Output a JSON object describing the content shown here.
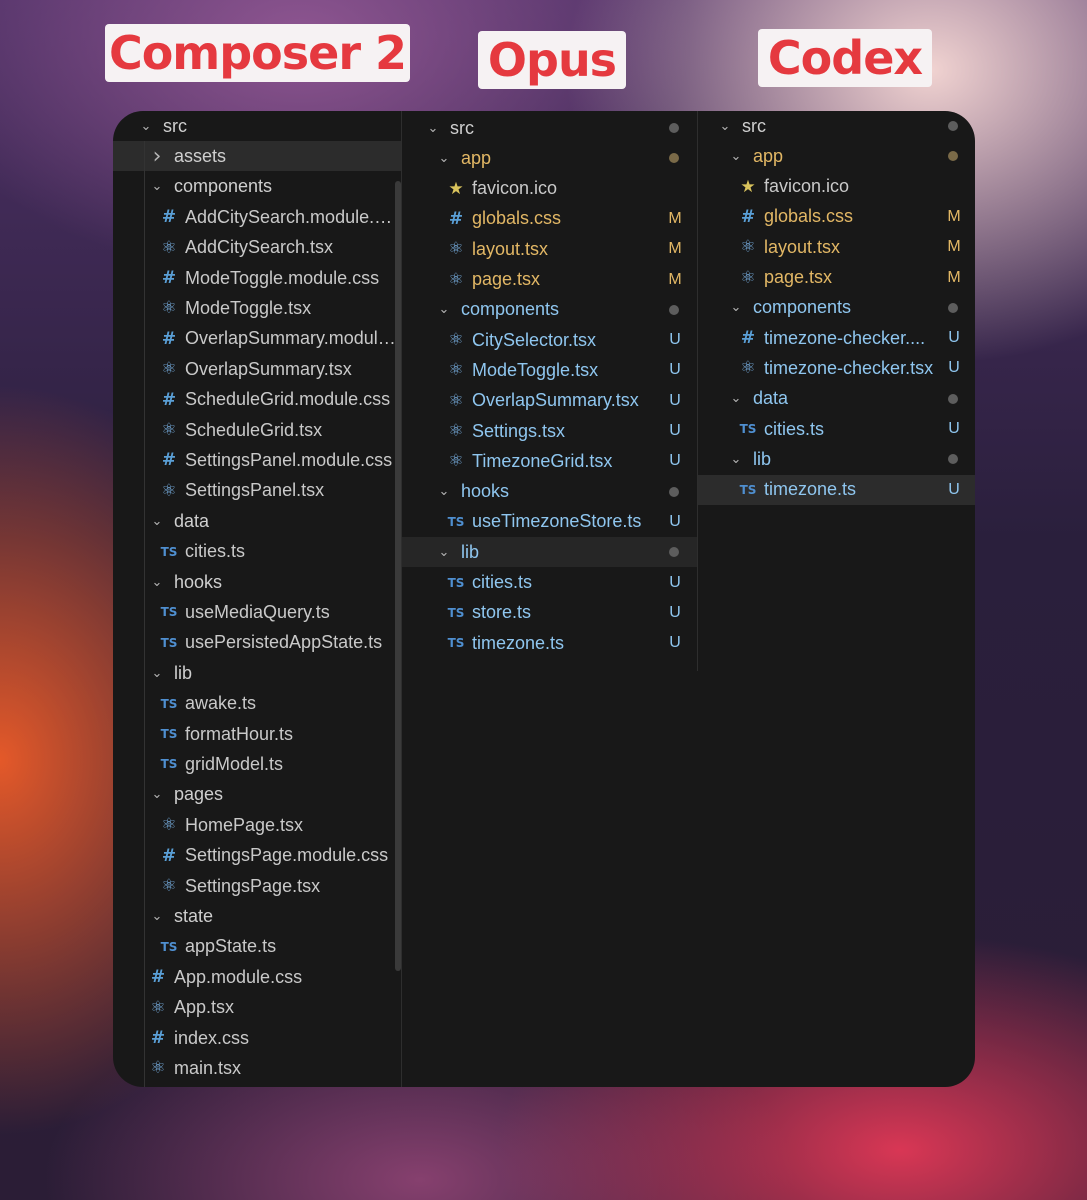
{
  "labels": {
    "left": "Composer 2",
    "middle": "Opus",
    "right": "Codex"
  },
  "composer": {
    "rows": [
      {
        "type": "folder",
        "chev": "v",
        "name": "src",
        "level": 0
      },
      {
        "type": "folder",
        "chev": ">",
        "name": "assets",
        "level": 1,
        "selected": true
      },
      {
        "type": "folder",
        "chev": "v",
        "name": "components",
        "level": 1
      },
      {
        "type": "file",
        "icon": "hash",
        "name": "AddCitySearch.module.css",
        "level": 2
      },
      {
        "type": "file",
        "icon": "react",
        "name": "AddCitySearch.tsx",
        "level": 2
      },
      {
        "type": "file",
        "icon": "hash",
        "name": "ModeToggle.module.css",
        "level": 2
      },
      {
        "type": "file",
        "icon": "react",
        "name": "ModeToggle.tsx",
        "level": 2
      },
      {
        "type": "file",
        "icon": "hash",
        "name": "OverlapSummary.module...",
        "level": 2
      },
      {
        "type": "file",
        "icon": "react",
        "name": "OverlapSummary.tsx",
        "level": 2
      },
      {
        "type": "file",
        "icon": "hash",
        "name": "ScheduleGrid.module.css",
        "level": 2
      },
      {
        "type": "file",
        "icon": "react",
        "name": "ScheduleGrid.tsx",
        "level": 2
      },
      {
        "type": "file",
        "icon": "hash",
        "name": "SettingsPanel.module.css",
        "level": 2
      },
      {
        "type": "file",
        "icon": "react",
        "name": "SettingsPanel.tsx",
        "level": 2
      },
      {
        "type": "folder",
        "chev": "v",
        "name": "data",
        "level": 1
      },
      {
        "type": "file",
        "icon": "ts",
        "name": "cities.ts",
        "level": 2
      },
      {
        "type": "folder",
        "chev": "v",
        "name": "hooks",
        "level": 1
      },
      {
        "type": "file",
        "icon": "ts",
        "name": "useMediaQuery.ts",
        "level": 2
      },
      {
        "type": "file",
        "icon": "ts",
        "name": "usePersistedAppState.ts",
        "level": 2
      },
      {
        "type": "folder",
        "chev": "v",
        "name": "lib",
        "level": 1
      },
      {
        "type": "file",
        "icon": "ts",
        "name": "awake.ts",
        "level": 2
      },
      {
        "type": "file",
        "icon": "ts",
        "name": "formatHour.ts",
        "level": 2
      },
      {
        "type": "file",
        "icon": "ts",
        "name": "gridModel.ts",
        "level": 2
      },
      {
        "type": "folder",
        "chev": "v",
        "name": "pages",
        "level": 1
      },
      {
        "type": "file",
        "icon": "react",
        "name": "HomePage.tsx",
        "level": 2
      },
      {
        "type": "file",
        "icon": "hash",
        "name": "SettingsPage.module.css",
        "level": 2
      },
      {
        "type": "file",
        "icon": "react",
        "name": "SettingsPage.tsx",
        "level": 2
      },
      {
        "type": "folder",
        "chev": "v",
        "name": "state",
        "level": 1
      },
      {
        "type": "file",
        "icon": "ts",
        "name": "appState.ts",
        "level": 2
      },
      {
        "type": "file",
        "icon": "hash",
        "name": "App.module.css",
        "level": 1
      },
      {
        "type": "file",
        "icon": "react",
        "name": "App.tsx",
        "level": 1
      },
      {
        "type": "file",
        "icon": "hash",
        "name": "index.css",
        "level": 1
      },
      {
        "type": "file",
        "icon": "react",
        "name": "main.tsx",
        "level": 1
      }
    ]
  },
  "opus": {
    "rows": [
      {
        "type": "folder",
        "chev": "v",
        "name": "src",
        "level": 0,
        "dot": true
      },
      {
        "type": "folder",
        "chev": "v",
        "name": "app",
        "level": 1,
        "dot": true,
        "dotColor": "#7a6a48",
        "nameColor": "#e2b765"
      },
      {
        "type": "file",
        "icon": "star",
        "name": "favicon.ico",
        "level": 2,
        "cls": "plain"
      },
      {
        "type": "file",
        "icon": "hash",
        "name": "globals.css",
        "level": 2,
        "status": "M"
      },
      {
        "type": "file",
        "icon": "react",
        "name": "layout.tsx",
        "level": 2,
        "status": "M"
      },
      {
        "type": "file",
        "icon": "react",
        "name": "page.tsx",
        "level": 2,
        "status": "M"
      },
      {
        "type": "folder",
        "chev": "v",
        "name": "components",
        "level": 1,
        "dot": true,
        "nameColor": "#8fc6ef"
      },
      {
        "type": "file",
        "icon": "react",
        "name": "CitySelector.tsx",
        "level": 2,
        "status": "U"
      },
      {
        "type": "file",
        "icon": "react",
        "name": "ModeToggle.tsx",
        "level": 2,
        "status": "U"
      },
      {
        "type": "file",
        "icon": "react",
        "name": "OverlapSummary.tsx",
        "level": 2,
        "status": "U"
      },
      {
        "type": "file",
        "icon": "react",
        "name": "Settings.tsx",
        "level": 2,
        "status": "U"
      },
      {
        "type": "file",
        "icon": "react",
        "name": "TimezoneGrid.tsx",
        "level": 2,
        "status": "U"
      },
      {
        "type": "folder",
        "chev": "v",
        "name": "hooks",
        "level": 1,
        "dot": true,
        "nameColor": "#8fc6ef"
      },
      {
        "type": "file",
        "icon": "ts",
        "name": "useTimezoneStore.ts",
        "level": 2,
        "status": "U"
      },
      {
        "type": "folder",
        "chev": "v",
        "name": "lib",
        "level": 1,
        "dot": true,
        "nameColor": "#8fc6ef",
        "hover": true
      },
      {
        "type": "file",
        "icon": "ts",
        "name": "cities.ts",
        "level": 2,
        "status": "U"
      },
      {
        "type": "file",
        "icon": "ts",
        "name": "store.ts",
        "level": 2,
        "status": "U"
      },
      {
        "type": "file",
        "icon": "ts",
        "name": "timezone.ts",
        "level": 2,
        "status": "U"
      }
    ]
  },
  "codex": {
    "rows": [
      {
        "type": "folder",
        "chev": "v",
        "name": "src",
        "level": 0,
        "dot": true
      },
      {
        "type": "folder",
        "chev": "v",
        "name": "app",
        "level": 1,
        "dot": true,
        "dotColor": "#7a6a48",
        "nameColor": "#e2b765"
      },
      {
        "type": "file",
        "icon": "star",
        "name": "favicon.ico",
        "level": 2,
        "cls": "plain"
      },
      {
        "type": "file",
        "icon": "hash",
        "name": "globals.css",
        "level": 2,
        "status": "M"
      },
      {
        "type": "file",
        "icon": "react",
        "name": "layout.tsx",
        "level": 2,
        "status": "M"
      },
      {
        "type": "file",
        "icon": "react",
        "name": "page.tsx",
        "level": 2,
        "status": "M"
      },
      {
        "type": "folder",
        "chev": "v",
        "name": "components",
        "level": 1,
        "dot": true,
        "nameColor": "#8fc6ef"
      },
      {
        "type": "file",
        "icon": "hash",
        "name": "timezone-checker....",
        "level": 2,
        "status": "U"
      },
      {
        "type": "file",
        "icon": "react",
        "name": "timezone-checker.tsx",
        "level": 2,
        "status": "U"
      },
      {
        "type": "folder",
        "chev": "v",
        "name": "data",
        "level": 1,
        "dot": true,
        "nameColor": "#8fc6ef"
      },
      {
        "type": "file",
        "icon": "ts",
        "name": "cities.ts",
        "level": 2,
        "status": "U"
      },
      {
        "type": "folder",
        "chev": "v",
        "name": "lib",
        "level": 1,
        "dot": true,
        "nameColor": "#8fc6ef"
      },
      {
        "type": "file",
        "icon": "ts",
        "name": "timezone.ts",
        "level": 2,
        "status": "U",
        "selected": true
      }
    ]
  },
  "icons": {
    "hash": "hash-icon",
    "react": "react-icon",
    "ts": "typescript-icon",
    "star": "favicon-star-icon",
    "chevron_open": "chevron-down-icon",
    "chevron_closed": "chevron-right-icon"
  },
  "colors": {
    "modified": "#e2b765",
    "untracked": "#8fc6ef",
    "label_text": "#e5393f",
    "panel_bg": "#181818"
  }
}
